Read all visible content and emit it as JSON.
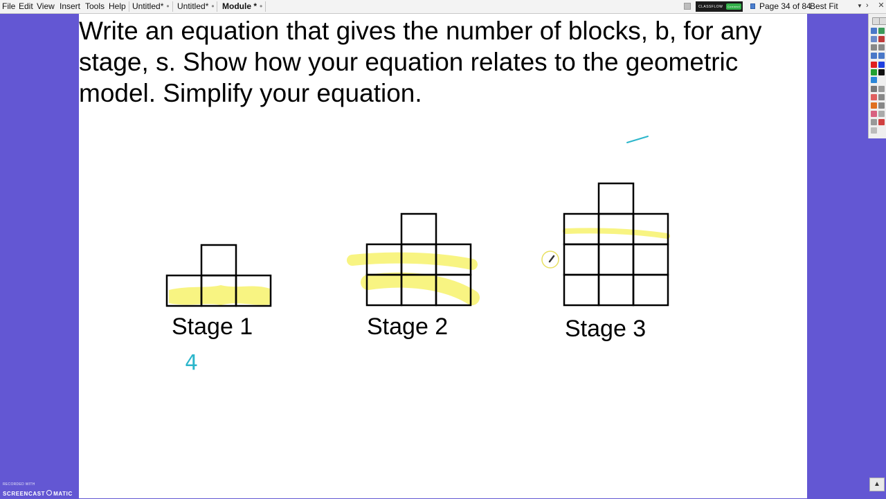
{
  "menu": [
    "File",
    "Edit",
    "View",
    "Insert",
    "Tools",
    "Help"
  ],
  "tabs": [
    {
      "label": "Untitled*",
      "close": "•"
    },
    {
      "label": "Untitled*",
      "close": "•"
    },
    {
      "label": "Module *",
      "close": "•"
    }
  ],
  "classflow": {
    "label": "CLASSFLOW",
    "action": "Connect"
  },
  "page_info": "Page 34 of 84",
  "zoom": "Best Fit",
  "prompt": "Write an equation that gives the number of blocks, b, for any\nstage, s. Show how your equation relates to the geometric\nmodel. Simplify your equation.",
  "stages": [
    {
      "label": "Stage 1",
      "rows": 1
    },
    {
      "label": "Stage 2",
      "rows": 2
    },
    {
      "label": "Stage 3",
      "rows": 3
    }
  ],
  "annotations": {
    "stage1_count": "4",
    "dash": "—"
  },
  "colors": {
    "background": "#6357d3",
    "highlight": "#f7f26c",
    "pen": "#2bb6cb",
    "block_stroke": "#000000"
  },
  "watermark": {
    "top": "RECORDED WITH",
    "left": "SCREENCAST",
    "right": "MATIC"
  }
}
